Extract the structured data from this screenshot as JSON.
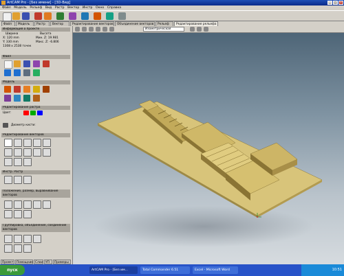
{
  "window": {
    "title": "ArtCAM Pro - [Без имени] - [3D-Вид]"
  },
  "menu": {
    "items": [
      "Файл",
      "Модель",
      "Рельеф",
      "Вид",
      "Растр",
      "Вектор",
      "Инстр",
      "Окно",
      "Справка"
    ]
  },
  "tabs": [
    "Файл",
    "Модель",
    "Растр",
    "Вектор",
    "Редактирование векторов",
    "Объединение векторов",
    "Рельеф",
    "Редактирование рельефа"
  ],
  "sidebar": {
    "sections": [
      "Информация о проекте",
      "Файл",
      "Модель",
      "Редактирование растра",
      "Редактирование векторов",
      "Инстр. Растр",
      "Положение, размер, выравнивание векторов",
      "Группировка, объединение, соединение векторов"
    ],
    "info": {
      "width_label": "Ширина",
      "height_label": "Высота",
      "x_value": "X: 120 mm",
      "y_value": "Y: 330 mm",
      "min_z": "Мин. Z: 19.981",
      "max_z": "Макс. Z: -6.806",
      "resolution": "1308 x 2538 точек"
    },
    "color_label": "Цвет:",
    "brush_label": "Диаметр кисти:",
    "bottom_tabs": [
      "Проект",
      "Помощник",
      "Слои",
      "УП",
      "Примеры"
    ]
  },
  "viewport": {
    "view_select": "Изометрическая"
  },
  "taskbar": {
    "start_label": "пуск",
    "tasks": [
      "ArtCAM Pro - [Без им...",
      "Total Commander 6.51",
      "Excel - Microsoft Word"
    ],
    "clock": "10:51"
  },
  "colors": {
    "title": "#0a2a8a",
    "relief": "#c9b060",
    "taskbar": "#2753c8"
  }
}
